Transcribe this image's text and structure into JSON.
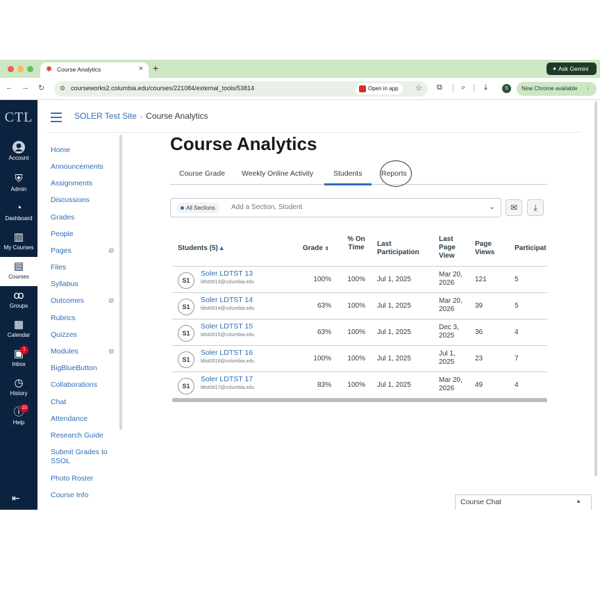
{
  "browser": {
    "tab_title": "Course Analytics",
    "tab_close": "×",
    "new_tab": "+",
    "gemini_label": "Ask Gemini",
    "url": "courseworks2.columbia.edu/courses/221084/external_tools/53814",
    "open_in_app": "Open in app",
    "profile_initial": "S",
    "new_chrome": "New Chrome available"
  },
  "global_nav": {
    "logo": "CTL",
    "items": [
      {
        "label": "Account",
        "icon": "account-icon"
      },
      {
        "label": "Admin",
        "icon": "shield-icon"
      },
      {
        "label": "Dashboard",
        "icon": "dashboard-icon"
      },
      {
        "label": "My Courses",
        "icon": "book-icon"
      },
      {
        "label": "Courses",
        "icon": "courses-icon"
      },
      {
        "label": "Groups",
        "icon": "groups-icon"
      },
      {
        "label": "Calendar",
        "icon": "calendar-icon"
      },
      {
        "label": "Inbox",
        "icon": "inbox-icon",
        "badge": "1"
      },
      {
        "label": "History",
        "icon": "history-icon"
      },
      {
        "label": "Help",
        "icon": "help-icon",
        "badge": "10"
      }
    ],
    "active": "Courses"
  },
  "breadcrumb": {
    "course": "SOLER Test Site",
    "separator": "›",
    "page": "Course Analytics"
  },
  "course_nav": [
    {
      "label": "Home"
    },
    {
      "label": "Announcements"
    },
    {
      "label": "Assignments"
    },
    {
      "label": "Discussions"
    },
    {
      "label": "Grades"
    },
    {
      "label": "People"
    },
    {
      "label": "Pages",
      "hidden": true
    },
    {
      "label": "Files"
    },
    {
      "label": "Syllabus"
    },
    {
      "label": "Outcomes",
      "hidden": true
    },
    {
      "label": "Rubrics"
    },
    {
      "label": "Quizzes"
    },
    {
      "label": "Modules",
      "hidden": true
    },
    {
      "label": "BigBlueButton"
    },
    {
      "label": "Collaborations"
    },
    {
      "label": "Chat"
    },
    {
      "label": "Attendance"
    },
    {
      "label": "Research Guide"
    },
    {
      "label": "Submit Grades to SSOL"
    },
    {
      "label": "Photo Roster"
    },
    {
      "label": "Course Info"
    }
  ],
  "main": {
    "title": "Course Analytics",
    "tabs": [
      "Course Grade",
      "Weekly Online Activity",
      "Students",
      "Reports"
    ],
    "selected_tab": "Students",
    "filter": {
      "chip": "All Sections",
      "placeholder": "Add a Section, Student"
    },
    "table": {
      "headers": {
        "student": "Students (5)",
        "grade": "Grade",
        "ontime": "% On Time",
        "last_part": "Last Participation",
        "last_view": "Last Page View",
        "views": "Page Views",
        "participations": "Participat"
      },
      "rows": [
        {
          "initials": "S1",
          "name": "Soler LDTST 13",
          "email": "ldtst0013@columbia.edu",
          "grade": "100%",
          "ontime": "100%",
          "last_part": "Jul 1, 2025",
          "last_view": "Mar 20, 2026",
          "views": "121",
          "parts": "5"
        },
        {
          "initials": "S1",
          "name": "Soler LDTST 14",
          "email": "ldtst0014@columbia.edu",
          "grade": "63%",
          "ontime": "100%",
          "last_part": "Jul 1, 2025",
          "last_view": "Mar 20, 2026",
          "views": "39",
          "parts": "5"
        },
        {
          "initials": "S1",
          "name": "Soler LDTST 15",
          "email": "ldtst0015@columbia.edu",
          "grade": "63%",
          "ontime": "100%",
          "last_part": "Jul 1, 2025",
          "last_view": "Dec 3, 2025",
          "views": "36",
          "parts": "4"
        },
        {
          "initials": "S1",
          "name": "Soler LDTST 16",
          "email": "ldtst0016@columbia.edu",
          "grade": "100%",
          "ontime": "100%",
          "last_part": "Jul 1, 2025",
          "last_view": "Jul 1, 2025",
          "views": "23",
          "parts": "7"
        },
        {
          "initials": "S1",
          "name": "Soler LDTST 17",
          "email": "ldtst0017@columbia.edu",
          "grade": "83%",
          "ontime": "100%",
          "last_part": "Jul 1, 2025",
          "last_view": "Mar 20, 2026",
          "views": "49",
          "parts": "4"
        }
      ]
    }
  },
  "chat": {
    "label": "Course Chat"
  }
}
